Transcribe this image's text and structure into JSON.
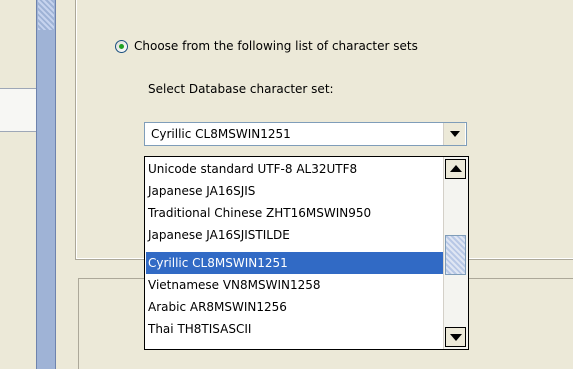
{
  "charset_section": {
    "radio_label": "Choose from the following list of character sets",
    "radio_selected": true,
    "select_label": "Select Database character set:",
    "combo_value": "Cyrillic CL8MSWIN1251",
    "options": [
      "Unicode standard UTF-8 AL32UTF8",
      "Japanese JA16SJIS",
      "Traditional Chinese ZHT16MSWIN950",
      "Japanese JA16SJISTILDE",
      "Cyrillic CL8MSWIN1251",
      "Vietnamese VN8MSWIN1258",
      "Arabic AR8MSWIN1256",
      "Thai TH8TISASCII"
    ],
    "selected_index": 4
  },
  "colors": {
    "selection": "#316ac5",
    "radio_dot": "#21a121",
    "background": "#ece9d8"
  }
}
